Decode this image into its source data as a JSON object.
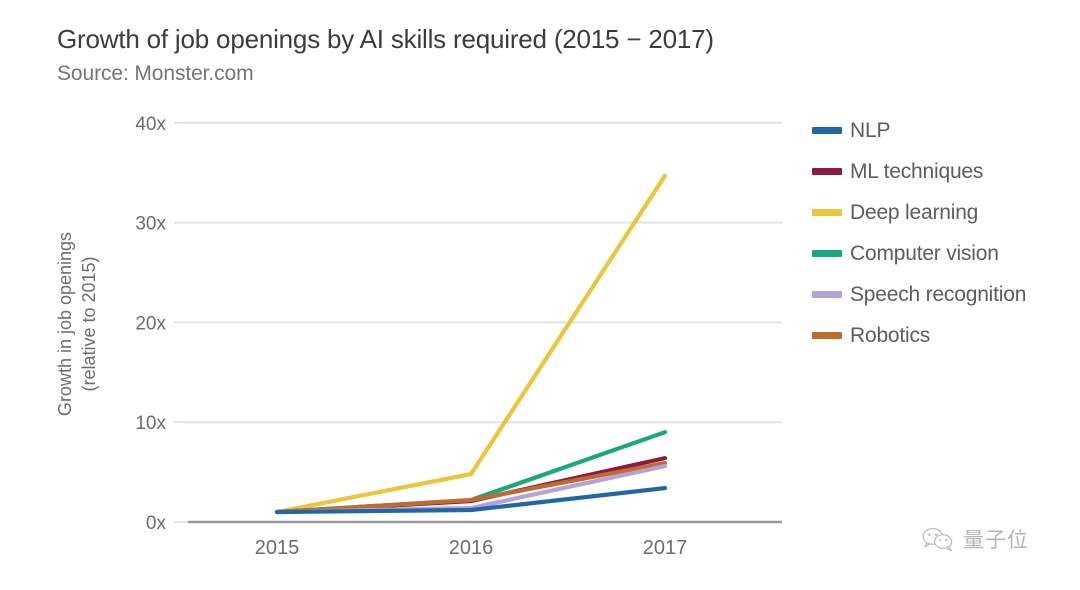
{
  "chart_data": {
    "type": "line",
    "title": "Growth of job openings by AI skills required (2015 − 2017)",
    "subtitle": "Source: Monster.com",
    "xlabel": "",
    "ylabel": "Growth in job openings\n(relative to 2015)",
    "ylabel_line1": "Growth in job openings",
    "ylabel_line2": "(relative to 2015)",
    "categories": [
      "2015",
      "2016",
      "2017"
    ],
    "x": [
      2015,
      2016,
      2017
    ],
    "ylim": [
      0,
      42
    ],
    "yticks": [
      0,
      10,
      20,
      30,
      40
    ],
    "ytick_labels": [
      "0x",
      "10x",
      "20x",
      "30x",
      "40x"
    ],
    "grid": "horizontal",
    "legend_position": "right",
    "series": [
      {
        "name": "NLP",
        "color": "#2166a5",
        "values": [
          1.0,
          1.2,
          3.4
        ]
      },
      {
        "name": "ML techniques",
        "color": "#8c1b3f",
        "values": [
          1.0,
          2.1,
          6.4
        ]
      },
      {
        "name": "Deep learning",
        "color": "#ebc63c",
        "values": [
          1.0,
          4.8,
          34.7
        ]
      },
      {
        "name": "Computer vision",
        "color": "#19a87b",
        "values": [
          1.0,
          2.2,
          9.0
        ]
      },
      {
        "name": "Speech recognition",
        "color": "#b3a3d9",
        "values": [
          1.0,
          1.4,
          5.6
        ]
      },
      {
        "name": "Robotics",
        "color": "#c06a2c",
        "values": [
          1.0,
          2.2,
          5.9
        ]
      }
    ]
  },
  "legend": {
    "items": [
      {
        "label": "NLP",
        "color": "#2166a5"
      },
      {
        "label": "ML techniques",
        "color": "#8c1b3f"
      },
      {
        "label": "Deep learning",
        "color": "#ebc63c"
      },
      {
        "label": "Computer vision",
        "color": "#19a87b"
      },
      {
        "label": "Speech recognition",
        "color": "#b3a3d9"
      },
      {
        "label": "Robotics",
        "color": "#c06a2c"
      }
    ]
  },
  "watermark": {
    "text": "量子位",
    "icon": "wechat-icon"
  },
  "colors": {
    "title": "#3c3c3c",
    "subtitle": "#757575",
    "axis": "#9a9a9a",
    "grid": "#e3e3e3",
    "tick_text": "#6d6d6d",
    "background": "#ffffff"
  }
}
